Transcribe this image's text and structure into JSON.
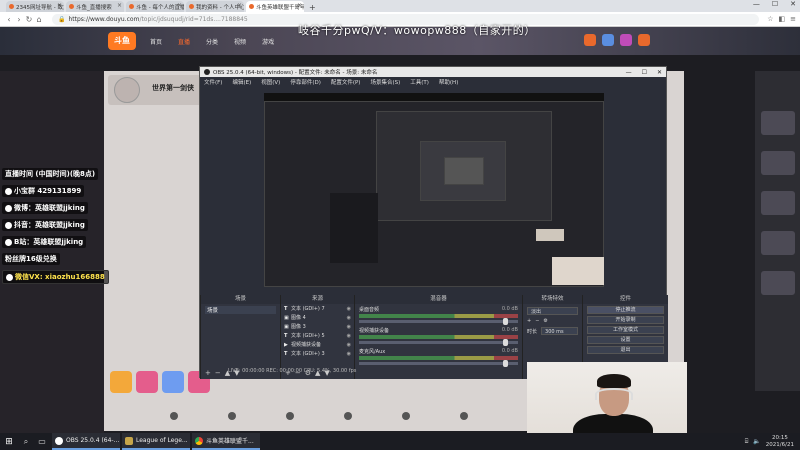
{
  "browser": {
    "tabs": [
      {
        "label": "2345网址导航 - 致力于打造百",
        "active": false
      },
      {
        "label": "斗鱼_直播搜索",
        "active": false
      },
      {
        "label": "斗鱼 - 每个人的直播平台",
        "active": false
      },
      {
        "label": "我的资料 - 个人中心 - 斗鱼",
        "active": false
      },
      {
        "label": "斗鱼英雄联盟千哥年电竞局",
        "active": true
      }
    ],
    "new_tab": "+",
    "url_host": "https://www.douyu.com",
    "url_path": "/topic/jdsuqudj/rid=71ds....7188845",
    "window_controls": [
      "—",
      "☐",
      "✕"
    ]
  },
  "douyu": {
    "logo": "斗鱼",
    "nav": [
      "首页",
      "直播",
      "分类",
      "视频",
      "游戏"
    ],
    "watermark": "岐谷千分pwQ/V：wowopw888（自家开的）",
    "anchor_title": "世界第一剑侠",
    "overlay_lines": [
      "直播时间  (中国时间)(晚8点)",
      "小宝群  429131899",
      "微博：英雄联盟jjking",
      "抖音：英雄联盟jjking",
      "B站：英雄联盟jjking",
      "粉丝牌16级兑换",
      "微信VX: xiaozhu166888"
    ]
  },
  "obs": {
    "title": "OBS 25.0.4 (64-bit, windows) - 配置文件: 未命名 - 场景: 未命名",
    "menu": [
      "文件(F)",
      "编辑(E)",
      "视图(V)",
      "停靠部件(D)",
      "配置文件(P)",
      "场景集合(S)",
      "工具(T)",
      "帮助(H)"
    ],
    "docks": {
      "scenes": {
        "header": "场景",
        "items": [
          "场景"
        ]
      },
      "sources": {
        "header": "来源",
        "items": [
          {
            "type": "T",
            "label": "文本 (GDI+) 7"
          },
          {
            "type": "",
            "label": "图像 4"
          },
          {
            "type": "",
            "label": "图像 3"
          },
          {
            "type": "T",
            "label": "文本 (GDI+) 5"
          },
          {
            "type": "",
            "label": "视频捕获设备"
          },
          {
            "type": "T",
            "label": "文本 (GDI+) 3"
          }
        ]
      },
      "mixer": {
        "header": "混音器",
        "channels": [
          {
            "name": "桌面音频",
            "db": "0.0 dB"
          },
          {
            "name": "视频捕获设备",
            "db": "0.0 dB"
          },
          {
            "name": "麦克风/Aux",
            "db": "0.0 dB"
          }
        ]
      },
      "transitions": {
        "header": "转场特效",
        "type": "淡出",
        "duration_label": "时长",
        "duration": "300 ms"
      },
      "controls": {
        "header": "控件",
        "buttons": [
          "停止推流",
          "开始录制",
          "工作室模式",
          "设置",
          "退出"
        ]
      }
    },
    "status": "LIVE: 00:00:00   REC: 00:00:00   CPU: 5.4%, 30.00 fps"
  },
  "taskbar": {
    "start": "⊞",
    "apps": [
      {
        "label": "OBS 25.0.4 (64-..."
      },
      {
        "label": "League of Lege..."
      },
      {
        "label": "斗鱼英雄联盟千..."
      }
    ],
    "time": "20:15",
    "date": "2021/6/21"
  }
}
